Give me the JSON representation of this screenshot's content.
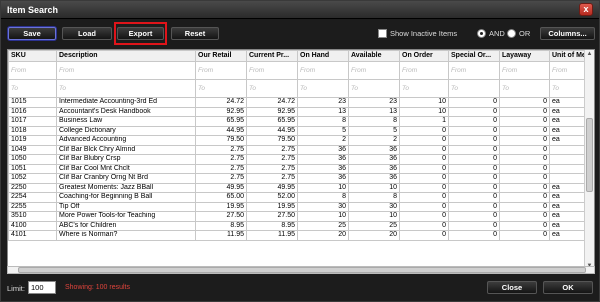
{
  "window": {
    "title": "Item Search",
    "close_glyph": "x"
  },
  "toolbar": {
    "save_label": "Save",
    "load_label": "Load",
    "export_label": "Export",
    "reset_label": "Reset",
    "show_inactive_label": "Show Inactive Items",
    "and_label": "AND",
    "or_label": "OR",
    "columns_label": "Columns..."
  },
  "filters": {
    "from": [
      "From",
      "From",
      "From",
      "From",
      "From",
      "From",
      "From",
      "From",
      "From",
      "From",
      "From"
    ],
    "to": [
      "To",
      "To",
      "To",
      "To",
      "To",
      "To",
      "To",
      "To",
      "To",
      "To",
      "To"
    ]
  },
  "columns": [
    "SKU",
    "Description",
    "Our Retail",
    "Current Pr...",
    "On Hand",
    "Available",
    "On Order",
    "Special Or...",
    "Layaway",
    "Unit of Me..."
  ],
  "rows": [
    [
      "1015",
      "Intermediate Accounting-3rd Ed",
      "24.72",
      "24.72",
      "23",
      "23",
      "10",
      "0",
      "0",
      "ea"
    ],
    [
      "1016",
      "Accountant's Desk Handbook",
      "92.95",
      "92.95",
      "13",
      "13",
      "10",
      "0",
      "0",
      "ea"
    ],
    [
      "1017",
      "Business Law",
      "65.95",
      "65.95",
      "8",
      "8",
      "1",
      "0",
      "0",
      "ea"
    ],
    [
      "1018",
      "College Dictionary",
      "44.95",
      "44.95",
      "5",
      "5",
      "0",
      "0",
      "0",
      "ea"
    ],
    [
      "1019",
      "Advanced Accounting",
      "79.50",
      "79.50",
      "2",
      "2",
      "0",
      "0",
      "0",
      "ea"
    ],
    [
      "1049",
      "Clif Bar Blck Chry Almnd",
      "2.75",
      "2.75",
      "36",
      "36",
      "0",
      "0",
      "0",
      ""
    ],
    [
      "1050",
      "Clif Bar Blubry Crsp",
      "2.75",
      "2.75",
      "36",
      "36",
      "0",
      "0",
      "0",
      ""
    ],
    [
      "1051",
      "Clif Bar Cool Mnt Chclt",
      "2.75",
      "2.75",
      "36",
      "36",
      "0",
      "0",
      "0",
      ""
    ],
    [
      "1052",
      "Clif Bar Cranbry Orng Nt Brd",
      "2.75",
      "2.75",
      "36",
      "36",
      "0",
      "0",
      "0",
      ""
    ],
    [
      "2250",
      "Greatest Moments: Jazz BBall",
      "49.95",
      "49.95",
      "10",
      "10",
      "0",
      "0",
      "0",
      "ea"
    ],
    [
      "2254",
      "Coaching-for Beginning B Ball",
      "65.00",
      "52.00",
      "8",
      "8",
      "0",
      "0",
      "0",
      "ea"
    ],
    [
      "2255",
      "Tip Off",
      "19.95",
      "19.95",
      "30",
      "30",
      "0",
      "0",
      "0",
      "ea"
    ],
    [
      "3510",
      "More Power Tools-for Teaching",
      "27.50",
      "27.50",
      "10",
      "10",
      "0",
      "0",
      "0",
      "ea"
    ],
    [
      "4100",
      "ABC's for Children",
      "8.95",
      "8.95",
      "25",
      "25",
      "0",
      "0",
      "0",
      "ea"
    ],
    [
      "4101",
      "Where is Norman?",
      "11.95",
      "11.95",
      "20",
      "20",
      "0",
      "0",
      "0",
      "ea"
    ]
  ],
  "footer": {
    "limit_label": "Limit:",
    "limit_value": "100",
    "showing_text": "Showing: 100 results",
    "close_label": "Close",
    "ok_label": "OK"
  }
}
